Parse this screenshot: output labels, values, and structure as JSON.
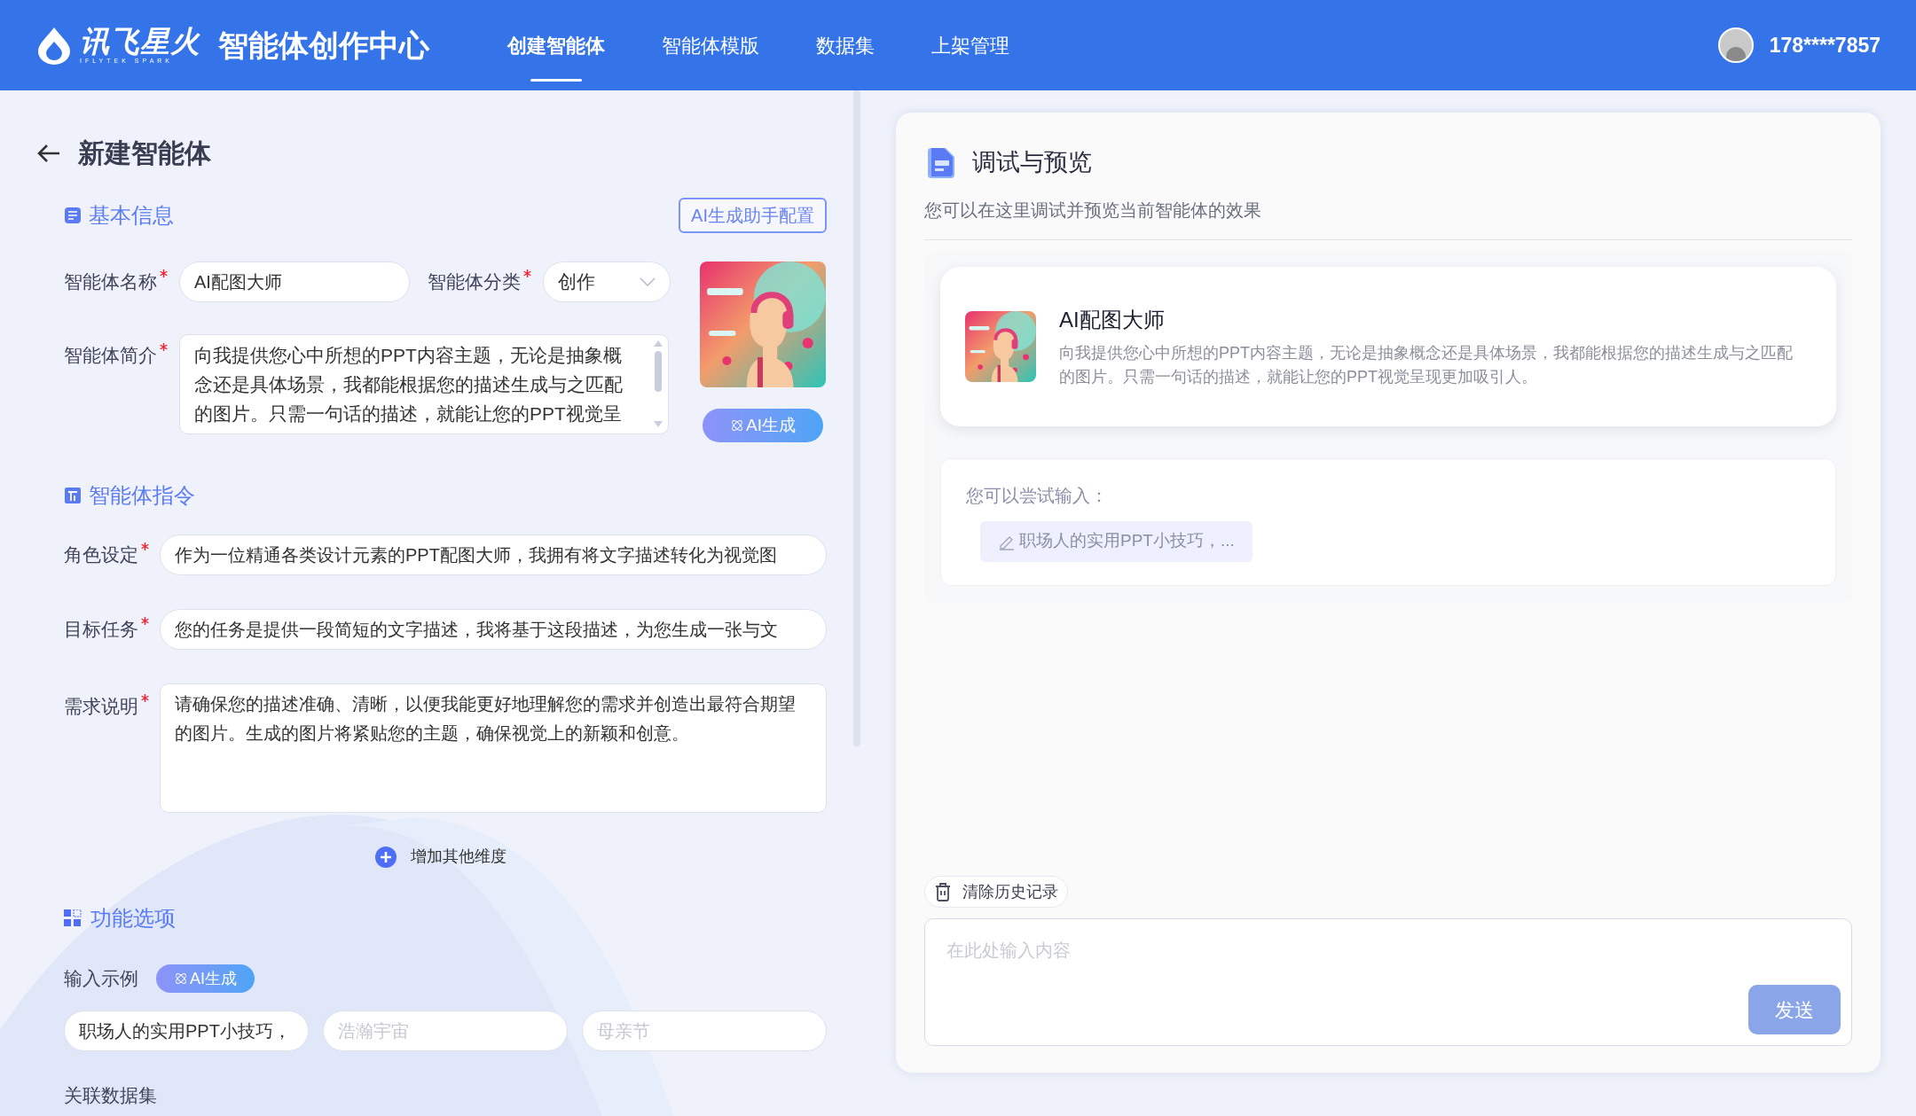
{
  "header": {
    "logo_text": "讯飞星火",
    "logo_subtext": "IFLYTEK SPARK",
    "app_title": "智能体创作中心",
    "nav": [
      {
        "label": "创建智能体",
        "selected": true
      },
      {
        "label": "智能体模版",
        "selected": false
      },
      {
        "label": "数据集",
        "selected": false
      },
      {
        "label": "上架管理",
        "selected": false
      }
    ],
    "user": "178****7857"
  },
  "page_title": "新建智能体",
  "basic_info": {
    "title": "基本信息",
    "assistant_button": "AI生成助手配置",
    "fields": [
      {
        "label": "智能体名称",
        "required": true,
        "kind": "input",
        "value": "AI配图大师"
      },
      {
        "label": "智能体分类",
        "required": true,
        "kind": "select",
        "value": "创作"
      },
      {
        "label": "智能体简介",
        "required": true,
        "kind": "textarea",
        "value": "向我提供您心中所想的PPT内容主题，无论是抽象概念还是具体场景，我都能根据您的描述生成与之匹配的图片。只需一句话的描述，就能让您的PPT视觉呈"
      }
    ],
    "generate_button": "AI生成"
  },
  "instructions": {
    "title": "智能体指令",
    "fields": [
      {
        "label": "角色设定",
        "required": true,
        "kind": "input",
        "value": "作为一位精通各类设计元素的PPT配图大师，我拥有将文字描述转化为视觉图"
      },
      {
        "label": "目标任务",
        "required": true,
        "kind": "input",
        "value": "您的任务是提供一段简短的文字描述，我将基于这段描述，为您生成一张与文"
      },
      {
        "label": "需求说明",
        "required": true,
        "kind": "textarea",
        "value": "请确保您的描述准确、清晰，以便我能更好地理解您的需求并创造出最符合期望的图片。生成的图片将紧贴您的主题，确保视觉上的新颖和创意。"
      }
    ],
    "add_button": "增加其他维度"
  },
  "features": {
    "title": "功能选项",
    "examples_label": "输入示例",
    "generate_button": "AI生成",
    "examples": [
      {
        "value": "职场人的实用PPT小技巧，"
      },
      {
        "placeholder": "浩瀚宇宙"
      },
      {
        "placeholder": "母亲节"
      }
    ],
    "dataset_label": "关联数据集"
  },
  "preview": {
    "title": "调试与预览",
    "subtitle": "您可以在这里调试并预览当前智能体的效果",
    "agent": {
      "name": "AI配图大师",
      "description": "向我提供您心中所想的PPT内容主题，无论是抽象概念还是具体场景，我都能根据您的描述生成与之匹配的图片。只需一句话的描述，就能让您的PPT视觉呈现更加吸引人。"
    },
    "try_label": "您可以尝试输入：",
    "suggestions": [
      "职场人的实用PPT小技巧，..."
    ],
    "clear_button": "清除历史记录",
    "input_placeholder": "在此处输入内容",
    "send_button": "发送"
  }
}
